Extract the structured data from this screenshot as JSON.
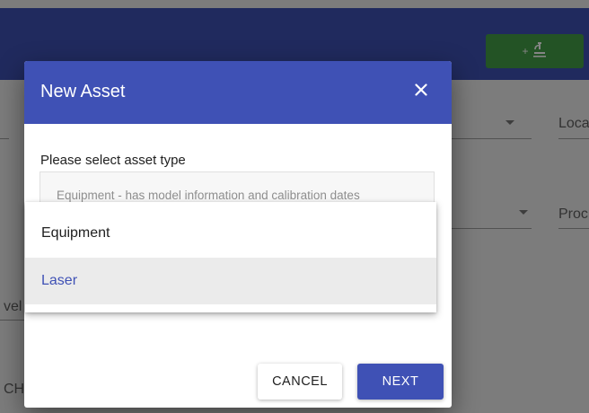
{
  "app": {
    "add_button_plus": "+",
    "add_button_icon": "microscope-icon",
    "bg_labels": {
      "location": "Loca",
      "product": "Proc",
      "level": "vel",
      "search": "CH"
    }
  },
  "dialog": {
    "title": "New Asset",
    "close_icon": "close-icon",
    "field_label": "Please select asset type",
    "field_hint": "Equipment - has model information and calibration dates",
    "options": [
      {
        "label": "Equipment"
      },
      {
        "label": "Laser"
      }
    ],
    "selected_option": "Laser",
    "cancel_label": "CANCEL",
    "next_label": "NEXT"
  },
  "colors": {
    "primary": "#3f51b5",
    "success": "#43a047"
  }
}
